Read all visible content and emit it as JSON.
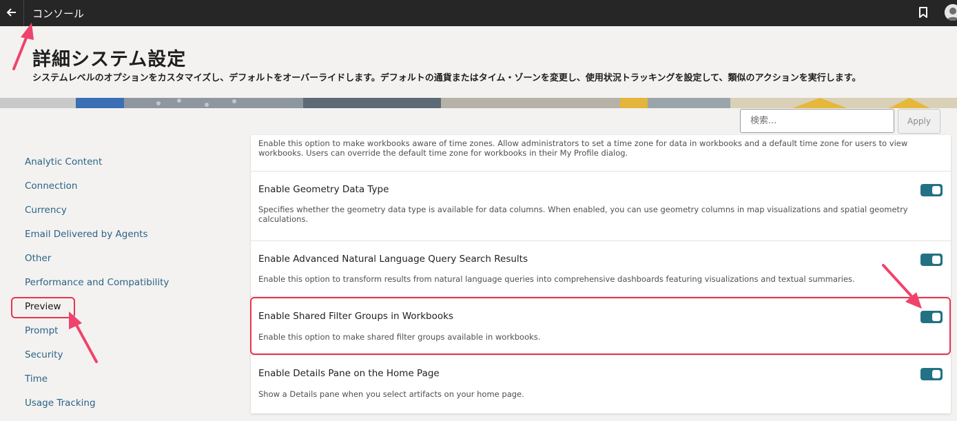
{
  "topbar": {
    "title": "コンソール",
    "back_icon": "arrow-left-icon",
    "bookmark_icon": "bookmark-icon"
  },
  "header": {
    "title": "詳細システム設定",
    "description": "システムレベルのオプションをカスタマイズし、デフォルトをオーバーライドします。デフォルトの通貨またはタイム・ゾーンを変更し、使用状況トラッキングを設定して、類似のアクションを実行します。"
  },
  "search": {
    "placeholder": "検索...",
    "apply_label": "Apply"
  },
  "sidebar": {
    "items": [
      {
        "label": "Analytic Content"
      },
      {
        "label": "Connection"
      },
      {
        "label": "Currency"
      },
      {
        "label": "Email Delivered by Agents"
      },
      {
        "label": "Other"
      },
      {
        "label": "Performance and Compatibility"
      },
      {
        "label": "Preview"
      },
      {
        "label": "Prompt"
      },
      {
        "label": "Security"
      },
      {
        "label": "Time"
      },
      {
        "label": "Usage Tracking"
      }
    ],
    "active": "Preview"
  },
  "settings": [
    {
      "title": "",
      "description": "Enable this option to make workbooks aware of time zones. Allow administrators to set a time zone for data in workbooks and a default time zone for users to view workbooks. Users can override the default time zone for workbooks in their My Profile dialog."
    },
    {
      "title": "Enable Geometry Data Type",
      "description": "Specifies whether the geometry data type is available for data columns. When enabled, you can use geometry columns in map visualizations and spatial geometry calculations.",
      "enabled": true
    },
    {
      "title": "Enable Advanced Natural Language Query Search Results",
      "description": "Enable this option to transform results from natural language queries into comprehensive dashboards featuring visualizations and textual summaries.",
      "enabled": true
    },
    {
      "title": "Enable Shared Filter Groups in Workbooks",
      "description": "Enable this option to make shared filter groups available in workbooks.",
      "enabled": true
    },
    {
      "title": "Enable Details Pane on the Home Page",
      "description": "Show a Details pane when you select artifacts on your home page.",
      "enabled": true
    }
  ],
  "colors": {
    "topbar": "#262626",
    "toggle_on": "#227184",
    "link": "#2a6385",
    "annotation": "#e8334f"
  }
}
